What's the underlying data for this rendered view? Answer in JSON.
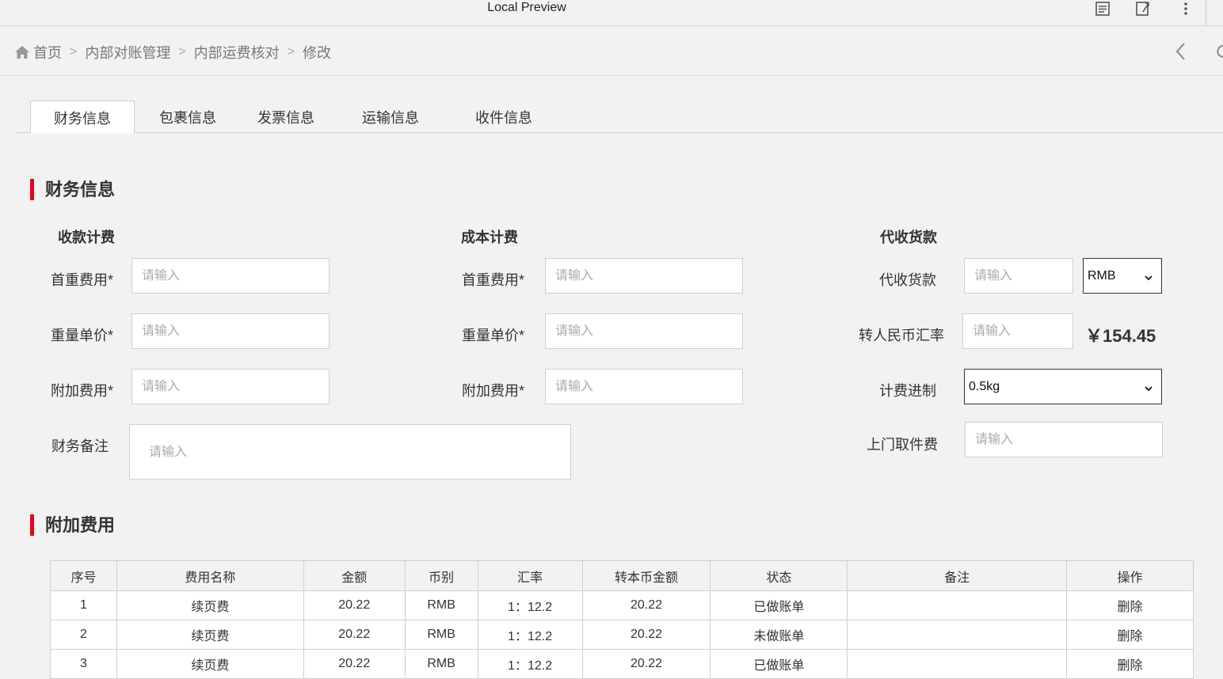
{
  "window": {
    "title": "Local Preview"
  },
  "breadcrumb": {
    "items": [
      "首页",
      "内部对账管理",
      "内部运费核对",
      "修改"
    ]
  },
  "tabs": [
    "财务信息",
    "包裹信息",
    "发票信息",
    "运输信息",
    "收件信息"
  ],
  "finance": {
    "section_title": "财务信息",
    "receivable": {
      "title": "收款计费",
      "first_weight_label": "首重费用*",
      "unit_price_label": "重量单价*",
      "extra_fee_label": "附加费用*"
    },
    "cost": {
      "title": "成本计费",
      "first_weight_label": "首重费用*",
      "unit_price_label": "重量单价*",
      "extra_fee_label": "附加费用*"
    },
    "cod": {
      "title": "代收货款",
      "cod_label": "代收货款",
      "currency_value": "RMB",
      "rate_label": "转人民币汇率",
      "rmb_amount": "￥154.45",
      "billing_label": "计费进制",
      "billing_value": "0.5kg",
      "pickup_label": "上门取件费"
    },
    "remark_label": "财务备注",
    "placeholder": "请输入"
  },
  "extra": {
    "section_title": "附加费用",
    "columns": [
      "序号",
      "费用名称",
      "金额",
      "币别",
      "汇率",
      "转本币金额",
      "状态",
      "备注",
      "操作"
    ],
    "rows": [
      [
        "1",
        "续页费",
        "20.22",
        "RMB",
        "1：12.2",
        "20.22",
        "已做账单",
        "",
        "删除"
      ],
      [
        "2",
        "续页费",
        "20.22",
        "RMB",
        "1：12.2",
        "20.22",
        "未做账单",
        "",
        "删除"
      ],
      [
        "3",
        "续页费",
        "20.22",
        "RMB",
        "1：12.2",
        "20.22",
        "已做账单",
        "",
        "删除"
      ]
    ]
  }
}
